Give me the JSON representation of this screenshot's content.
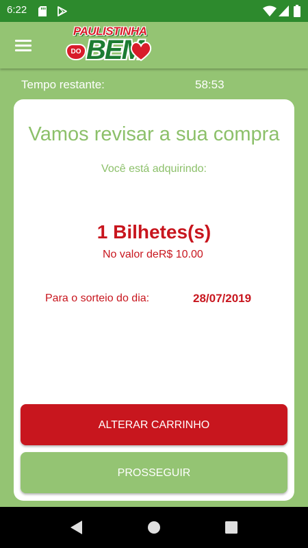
{
  "status_bar": {
    "time": "6:22",
    "icons": [
      "sd-card-icon",
      "play-store-icon",
      "wifi-icon",
      "signal-icon",
      "battery-icon"
    ]
  },
  "app_bar": {
    "logo": {
      "line1": "PAULISTINHA",
      "do": "DO",
      "bem": "BEM"
    },
    "menu_icon": "hamburger-menu-icon"
  },
  "timer": {
    "label": "Tempo restante:",
    "value": "58:53"
  },
  "review": {
    "title": "Vamos revisar a sua compra",
    "subtitle": "Você está adquirindo:",
    "quantity": "1 Bilhetes(s)",
    "price": "No valor deR$ 10.00",
    "draw_label": "Para o sorteio do dia:",
    "draw_date": "28/07/2019"
  },
  "buttons": {
    "alter_cart": "ALTERAR CARRINHO",
    "proceed": "PROSSEGUIR"
  },
  "colors": {
    "primary_green": "#94c473",
    "status_bar_green": "#2d8a2d",
    "accent_red": "#c8161e",
    "title_green": "#8cc06a"
  },
  "nav_bar": {
    "icons": [
      "back-icon",
      "home-icon",
      "recents-icon"
    ]
  }
}
